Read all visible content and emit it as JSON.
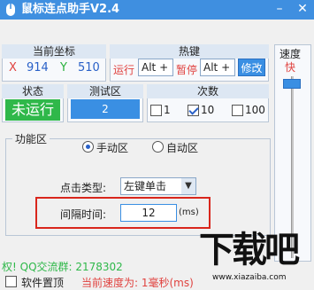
{
  "window": {
    "title": "鼠标连点助手V2.4",
    "min_glyph": "–",
    "close_glyph": "✕"
  },
  "coords": {
    "header": "当前坐标",
    "x_label": "X",
    "x_value": "914",
    "y_label": "Y",
    "y_value": "510"
  },
  "hotkey": {
    "header": "热键",
    "run_label": "运行",
    "run_value": "Alt +",
    "pause_label": "暂停",
    "pause_value": "Alt +",
    "modify_label": "修改"
  },
  "speed": {
    "label": "速度",
    "value": "快"
  },
  "status": {
    "header": "状态",
    "value": "未运行"
  },
  "test": {
    "header": "测试区",
    "value": "2"
  },
  "times": {
    "header": "次数",
    "options": [
      {
        "label": "1",
        "checked": false
      },
      {
        "label": "10",
        "checked": true
      },
      {
        "label": "100",
        "checked": false
      }
    ]
  },
  "function_area": {
    "legend": "功能区",
    "manual_label": "手动区",
    "auto_label": "自动区",
    "click_type_label": "点击类型:",
    "click_type_value": "左键单击",
    "interval_label": "间隔时间:",
    "interval_value": "12",
    "interval_unit": "(ms)"
  },
  "footer": {
    "left_text": "权! QQ交流群: 2178302",
    "pin_label": "软件置顶",
    "current_speed": "当前速度为: 1毫秒(ms)"
  },
  "watermark": {
    "brand": "下载吧",
    "url": "www.xiazaiba.com"
  },
  "colors": {
    "titlebar": "#3f8fe0",
    "status_bg": "#2fb84a",
    "test_bg": "#3a8fe3",
    "highlight_border": "#d9261c"
  }
}
